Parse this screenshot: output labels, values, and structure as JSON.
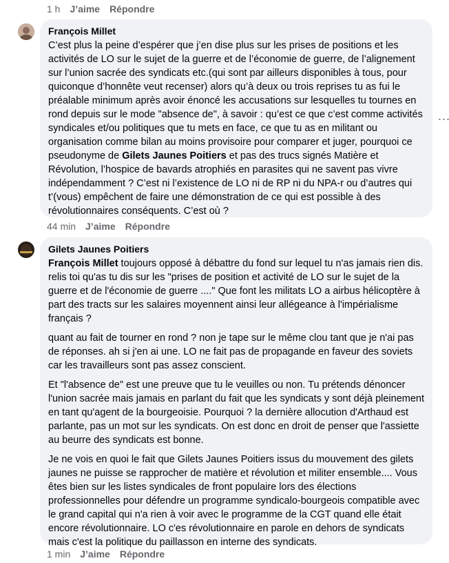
{
  "top_actions": {
    "time": "1 h",
    "like": "J’aime",
    "reply": "Répondre"
  },
  "comment1": {
    "author": "François Millet",
    "text_a": "C’est plus la peine d’espérer que j’en dise plus sur les prises de positions et les activités de LO sur le sujet de la guerre et de l’économie de guerre, de l’alignement sur l’union sacrée des syndicats etc.(qui sont par ailleurs disponibles à tous, pour quiconque d’honnête veut recenser) alors qu’à deux ou trois reprises tu as fui le préalable minimum après avoir énoncé les accusations sur lesquelles tu tournes en rond depuis sur le mode \"absence de\", à savoir : qu’est ce que c’est comme activités syndicales et/ou politiques que tu mets en face, ce que tu as en militant ou organisation comme bilan au moins provisoire pour comparer et juger, pourquoi ce pseudonyme de ",
    "mention": "Gilets Jaunes Poitiers",
    "text_b": " et pas des trucs signés Matière et Révolution, l’hospice de bavards atrophiés en parasites qui ne savent pas vivre indépendamment ? C’est ni l’existence de LO ni de RP ni du NPA-r ou d’autres qui t’(vous) empêchent de faire une démonstration de ce qui est possible à des révolutionnaires conséquents. C’est où ?",
    "more": "...",
    "actions": {
      "time": "44 min",
      "like": "J’aime",
      "reply": "Répondre"
    }
  },
  "comment2": {
    "author": "Gilets Jaunes Poitiers",
    "mention": "François Millet",
    "p1_rest": " toujours opposé à débattre du fond sur lequel tu n'as jamais rien dis. relis toi qu'as tu dis sur les \"prises de position et activité de LO sur le sujet de la guerre et de l'économie de guerre ....\" Que font les militats LO a airbus hélicoptère à part des tracts sur les salaires moyennent ainsi leur allégeance à l'impérialisme français ?",
    "p2": "quant au fait de tourner en rond ? non je tape sur le même clou tant que je n'ai pas de réponses. ah si j'en ai une. LO ne fait pas de propagande en faveur des soviets car les travailleurs sont pas assez conscient.",
    "p3": "Et \"l'absence de\" est une preuve que tu le veuilles ou non. Tu prétends dénoncer l'union sacrée mais jamais en parlant du fait que les syndicats y sont déjà pleinement en tant qu'agent de la bourgeoisie. Pourquoi ? la dernière allocution d'Arthaud est parlante, pas un mot sur les syndicats. On est donc en droit de penser que l'assiette au beurre des syndicats est bonne.",
    "p4": "Je ne vois en quoi le fait que Gilets Jaunes Poitiers issus du mouvement des gilets jaunes ne puisse se rapprocher de matière et révolution et militer ensemble.... Vous êtes bien sur les listes syndicales de front populaire lors des élections professionnelles pour défendre un programme syndicalo-bourgeois compatible avec le grand capital qui n'a rien à voir avec le programme de la CGT quand elle était encore révolutionnaire. LO c'es révolutionnaire en parole en dehors de syndicats mais c'est la politique du paillasson en interne des syndicats.",
    "actions": {
      "time": "1 min",
      "like": "J’aime",
      "reply": "Répondre"
    }
  }
}
